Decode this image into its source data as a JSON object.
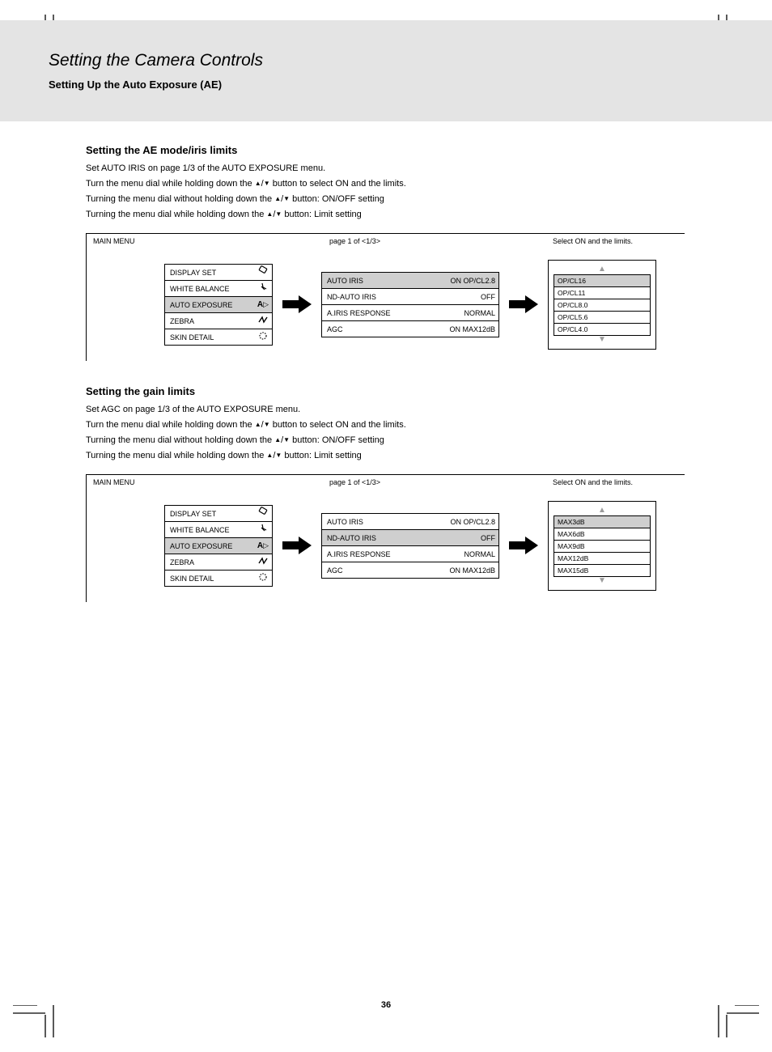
{
  "header": {
    "title": "Setting the Camera Controls",
    "subtitle": "Setting Up the Auto Exposure (AE)"
  },
  "section1": {
    "heading": "Setting the AE mode/iris limits",
    "lines": [
      "Set AUTO IRIS on page 1/3 of the AUTO EXPOSURE menu.",
      "Turn the menu dial while holding down the  /  button to select ON and the limits.",
      "Turning the menu dial without holding down the  /  button: ON/OFF setting",
      "Turning the menu dial while holding down the  /  button: Limit setting"
    ],
    "diagram": {
      "hint1": "MAIN MENU",
      "hint2": "page 1 of <1/3>",
      "hint3": "Select ON and the limits.",
      "menuA": {
        "items": [
          {
            "label": "DISPLAY SET",
            "icon": "eraser"
          },
          {
            "label": "WHITE BALANCE",
            "icon": "wand"
          },
          {
            "label": "AUTO EXPOSURE",
            "icon": "ae",
            "selected": true
          },
          {
            "label": "ZEBRA",
            "icon": "zebra"
          },
          {
            "label": "SKIN DETAIL",
            "icon": "skin"
          }
        ]
      },
      "menuB": {
        "items": [
          {
            "label": "AUTO IRIS",
            "value": "ON    OP/CL2.8",
            "selected": true
          },
          {
            "label": "ND-AUTO IRIS",
            "value": "OFF"
          },
          {
            "label": "A.IRIS RESPONSE",
            "value": "NORMAL"
          },
          {
            "label": "AGC",
            "value": "ON            MAX12dB"
          }
        ]
      },
      "select": {
        "items": [
          {
            "label": "OP/CL16",
            "selected": true
          },
          {
            "label": "OP/CL11"
          },
          {
            "label": "OP/CL8.0"
          },
          {
            "label": "OP/CL5.6"
          },
          {
            "label": "OP/CL4.0"
          }
        ]
      }
    }
  },
  "section2": {
    "heading": "Setting the gain limits",
    "lines": [
      "Set AGC on page 1/3 of the AUTO EXPOSURE menu.",
      "Turn the menu dial while holding down the  /  button to select ON and the limits.",
      "Turning the menu dial without holding down the  /  button: ON/OFF setting",
      "Turning the menu dial while holding down the  /  button: Limit setting"
    ],
    "diagram": {
      "hint1": "MAIN MENU",
      "hint2": "page 1 of <1/3>",
      "hint3": "Select ON and the limits.",
      "menuA": {
        "items": [
          {
            "label": "DISPLAY SET",
            "icon": "eraser"
          },
          {
            "label": "WHITE BALANCE",
            "icon": "wand"
          },
          {
            "label": "AUTO EXPOSURE",
            "icon": "ae",
            "selected": true
          },
          {
            "label": "ZEBRA",
            "icon": "zebra"
          },
          {
            "label": "SKIN DETAIL",
            "icon": "skin"
          }
        ]
      },
      "menuB": {
        "items": [
          {
            "label": "AUTO IRIS",
            "value": "ON    OP/CL2.8"
          },
          {
            "label": "ND-AUTO IRIS",
            "value": "OFF",
            "selected": true
          },
          {
            "label": "A.IRIS RESPONSE",
            "value": "NORMAL"
          },
          {
            "label": "AGC",
            "value": "ON            MAX12dB"
          }
        ]
      },
      "select": {
        "items": [
          {
            "label": "MAX3dB",
            "selected": true
          },
          {
            "label": "MAX6dB"
          },
          {
            "label": "MAX9dB"
          },
          {
            "label": "MAX12dB"
          },
          {
            "label": "MAX15dB"
          }
        ]
      }
    }
  },
  "page_number": "36"
}
